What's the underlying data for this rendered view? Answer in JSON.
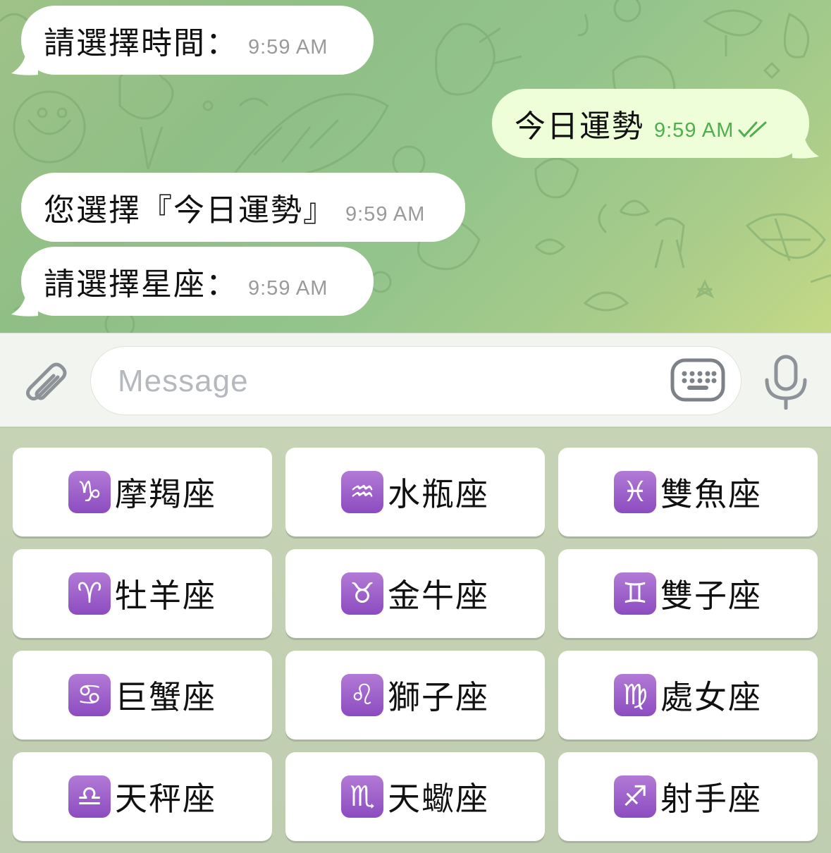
{
  "messages": [
    {
      "dir": "in",
      "text": "請選擇時間：",
      "time": "9:59 AM"
    },
    {
      "dir": "out",
      "text": "今日運勢",
      "time": "9:59 AM"
    },
    {
      "dir": "in",
      "text": "您選擇『今日運勢』",
      "time": "9:59 AM"
    },
    {
      "dir": "in",
      "text": "請選擇星座：",
      "time": "9:59 AM"
    }
  ],
  "input": {
    "placeholder": "Message"
  },
  "keyboard": [
    {
      "symbol": "♑",
      "icon": "capricorn-icon",
      "label": "摩羯座"
    },
    {
      "symbol": "♒",
      "icon": "aquarius-icon",
      "label": "水瓶座"
    },
    {
      "symbol": "♓",
      "icon": "pisces-icon",
      "label": "雙魚座"
    },
    {
      "symbol": "♈",
      "icon": "aries-icon",
      "label": "牡羊座"
    },
    {
      "symbol": "♉",
      "icon": "taurus-icon",
      "label": "金牛座"
    },
    {
      "symbol": "♊",
      "icon": "gemini-icon",
      "label": "雙子座"
    },
    {
      "symbol": "♋",
      "icon": "cancer-icon",
      "label": "巨蟹座"
    },
    {
      "symbol": "♌",
      "icon": "leo-icon",
      "label": "獅子座"
    },
    {
      "symbol": "♍",
      "icon": "virgo-icon",
      "label": "處女座"
    },
    {
      "symbol": "♎",
      "icon": "libra-icon",
      "label": "天秤座"
    },
    {
      "symbol": "♏",
      "icon": "scorpio-icon",
      "label": "天蠍座"
    },
    {
      "symbol": "♐",
      "icon": "sagittarius-icon",
      "label": "射手座"
    }
  ],
  "colors": {
    "outgoing_bubble": "#eefed9",
    "incoming_bubble": "#ffffff",
    "read_ticks": "#4fae4e",
    "zodiac_tile": "#9b5bcb"
  }
}
